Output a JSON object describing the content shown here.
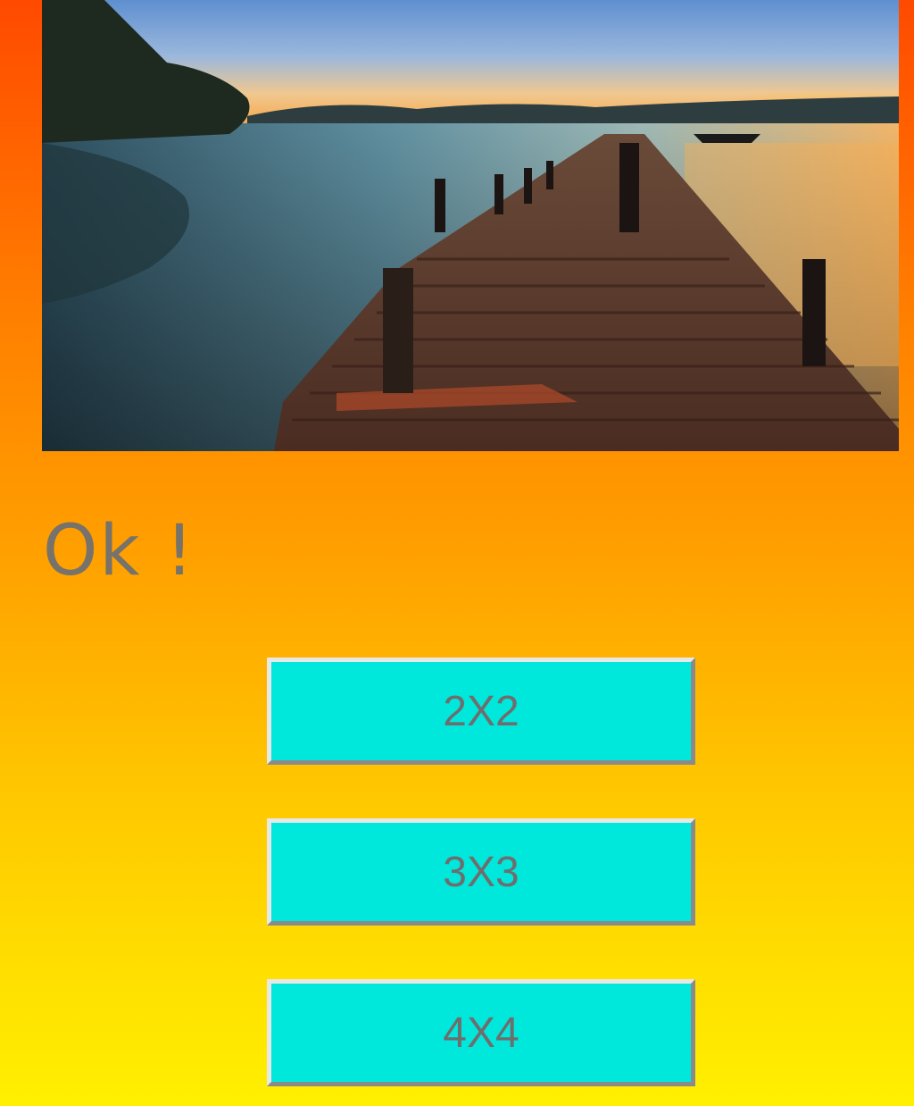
{
  "screen": {
    "title": "Ok !"
  },
  "buttons": [
    {
      "label": "2X2"
    },
    {
      "label": "3X3"
    },
    {
      "label": "4X4"
    }
  ],
  "colors": {
    "background_top": "#ff4a00",
    "background_bottom": "#fff000",
    "button_fill": "#00e8dc",
    "text_gray": "#707070"
  }
}
